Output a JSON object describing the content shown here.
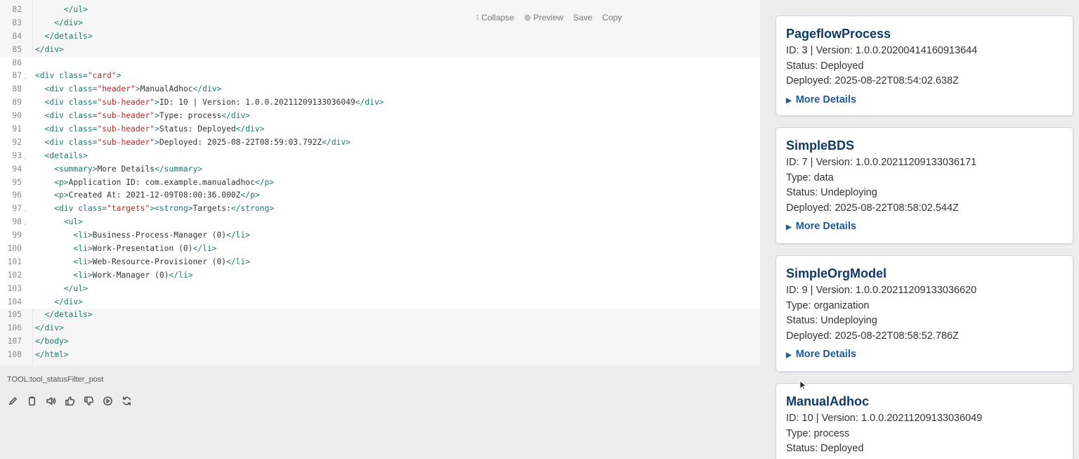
{
  "editor": {
    "toolbar": {
      "collapse": "⁝ Collapse",
      "preview": "⊚ Preview",
      "save": "Save",
      "copy": "Copy"
    },
    "lines": [
      {
        "n": "82",
        "fold": false,
        "hl": false,
        "indent": "      ",
        "parts": [
          [
            "tag",
            "</ul>"
          ]
        ]
      },
      {
        "n": "83",
        "fold": false,
        "hl": false,
        "indent": "    ",
        "parts": [
          [
            "tag",
            "</div>"
          ]
        ]
      },
      {
        "n": "84",
        "fold": false,
        "hl": false,
        "indent": "  ",
        "parts": [
          [
            "tag",
            "</details>"
          ]
        ]
      },
      {
        "n": "85",
        "fold": false,
        "hl": false,
        "indent": "",
        "parts": [
          [
            "tag",
            "</div>"
          ]
        ]
      },
      {
        "n": "86",
        "fold": false,
        "hl": true,
        "indent": "",
        "parts": []
      },
      {
        "n": "87",
        "fold": true,
        "hl": true,
        "indent": "",
        "parts": [
          [
            "tag",
            "<div "
          ],
          [
            "attr",
            "class="
          ],
          [
            "str",
            "\"card\""
          ],
          [
            "tag",
            ">"
          ]
        ]
      },
      {
        "n": "88",
        "fold": false,
        "hl": true,
        "indent": "  ",
        "parts": [
          [
            "tag",
            "<div "
          ],
          [
            "attr",
            "class="
          ],
          [
            "str",
            "\"header\""
          ],
          [
            "tag",
            ">"
          ],
          [
            "txt",
            "ManualAdhoc"
          ],
          [
            "tag",
            "</div>"
          ]
        ]
      },
      {
        "n": "89",
        "fold": false,
        "hl": true,
        "indent": "  ",
        "parts": [
          [
            "tag",
            "<div "
          ],
          [
            "attr",
            "class="
          ],
          [
            "str",
            "\"sub-header\""
          ],
          [
            "tag",
            ">"
          ],
          [
            "txt",
            "ID: 10 | Version: 1.0.0.20211209133036049"
          ],
          [
            "tag",
            "</div>"
          ]
        ]
      },
      {
        "n": "90",
        "fold": false,
        "hl": true,
        "indent": "  ",
        "parts": [
          [
            "tag",
            "<div "
          ],
          [
            "attr",
            "class="
          ],
          [
            "str",
            "\"sub-header\""
          ],
          [
            "tag",
            ">"
          ],
          [
            "txt",
            "Type: process"
          ],
          [
            "tag",
            "</div>"
          ]
        ]
      },
      {
        "n": "91",
        "fold": false,
        "hl": true,
        "indent": "  ",
        "parts": [
          [
            "tag",
            "<div "
          ],
          [
            "attr",
            "class="
          ],
          [
            "str",
            "\"sub-header\""
          ],
          [
            "tag",
            ">"
          ],
          [
            "txt",
            "Status: Deployed"
          ],
          [
            "tag",
            "</div>"
          ]
        ]
      },
      {
        "n": "92",
        "fold": false,
        "hl": true,
        "indent": "  ",
        "parts": [
          [
            "tag",
            "<div "
          ],
          [
            "attr",
            "class="
          ],
          [
            "str",
            "\"sub-header\""
          ],
          [
            "tag",
            ">"
          ],
          [
            "txt",
            "Deployed: 2025-08-22T08:59:03.792Z"
          ],
          [
            "tag",
            "</div>"
          ]
        ]
      },
      {
        "n": "93",
        "fold": true,
        "hl": true,
        "indent": "  ",
        "parts": [
          [
            "tag",
            "<details>"
          ]
        ]
      },
      {
        "n": "94",
        "fold": false,
        "hl": true,
        "indent": "    ",
        "parts": [
          [
            "tag",
            "<summary>"
          ],
          [
            "txt",
            "More Details"
          ],
          [
            "tag",
            "</summary>"
          ]
        ]
      },
      {
        "n": "95",
        "fold": false,
        "hl": true,
        "indent": "    ",
        "parts": [
          [
            "tag",
            "<p>"
          ],
          [
            "txt",
            "Application ID: com.example.manualadhoc"
          ],
          [
            "tag",
            "</p>"
          ]
        ]
      },
      {
        "n": "96",
        "fold": false,
        "hl": true,
        "indent": "    ",
        "parts": [
          [
            "tag",
            "<p>"
          ],
          [
            "txt",
            "Created At: 2021-12-09T08:00:36.000Z"
          ],
          [
            "tag",
            "</p>"
          ]
        ]
      },
      {
        "n": "97",
        "fold": true,
        "hl": true,
        "indent": "    ",
        "parts": [
          [
            "tag",
            "<div "
          ],
          [
            "attr",
            "class="
          ],
          [
            "str",
            "\"targets\""
          ],
          [
            "tag",
            "><strong>"
          ],
          [
            "txt",
            "Targets:"
          ],
          [
            "tag",
            "</strong>"
          ]
        ]
      },
      {
        "n": "98",
        "fold": true,
        "hl": true,
        "indent": "      ",
        "parts": [
          [
            "tag",
            "<ul>"
          ]
        ]
      },
      {
        "n": "99",
        "fold": false,
        "hl": true,
        "indent": "        ",
        "parts": [
          [
            "tag",
            "<li>"
          ],
          [
            "txt",
            "Business-Process-Manager (0)"
          ],
          [
            "tag",
            "</li>"
          ]
        ]
      },
      {
        "n": "100",
        "fold": false,
        "hl": true,
        "indent": "        ",
        "parts": [
          [
            "tag",
            "<li>"
          ],
          [
            "txt",
            "Work-Presentation (0)"
          ],
          [
            "tag",
            "</li>"
          ]
        ]
      },
      {
        "n": "101",
        "fold": false,
        "hl": true,
        "indent": "        ",
        "parts": [
          [
            "tag",
            "<li>"
          ],
          [
            "txt",
            "Web-Resource-Provisioner (0)"
          ],
          [
            "tag",
            "</li>"
          ]
        ]
      },
      {
        "n": "102",
        "fold": false,
        "hl": true,
        "indent": "        ",
        "parts": [
          [
            "tag",
            "<li>"
          ],
          [
            "txt",
            "Work-Manager (0)"
          ],
          [
            "tag",
            "</li>"
          ]
        ]
      },
      {
        "n": "103",
        "fold": false,
        "hl": true,
        "indent": "      ",
        "parts": [
          [
            "tag",
            "</ul>"
          ]
        ]
      },
      {
        "n": "104",
        "fold": false,
        "hl": true,
        "indent": "    ",
        "parts": [
          [
            "tag",
            "</div>"
          ]
        ]
      },
      {
        "n": "105",
        "fold": false,
        "hl": false,
        "indent": "  ",
        "parts": [
          [
            "tag",
            "</details>"
          ]
        ]
      },
      {
        "n": "106",
        "fold": false,
        "hl": false,
        "indent": "",
        "parts": [
          [
            "tag",
            "</div>"
          ]
        ]
      },
      {
        "n": "107",
        "fold": false,
        "hl": false,
        "indent": "",
        "parts": [
          [
            "tag",
            "</body>"
          ]
        ]
      },
      {
        "n": "108",
        "fold": false,
        "hl": false,
        "indent": "",
        "parts": [
          [
            "tag",
            "</html>"
          ]
        ]
      }
    ]
  },
  "tool_label": "TOOL:tool_statusFilter_post",
  "actions": [
    "edit-icon",
    "copy-icon",
    "speaker-icon",
    "thumbs-up-icon",
    "thumbs-down-icon",
    "play-icon",
    "refresh-icon"
  ],
  "cards": [
    {
      "header": "PageflowProcess",
      "lines": [
        "ID: 3 | Version: 1.0.0.20200414160913644",
        "Status: Deployed",
        "Deployed: 2025-08-22T08:54:02.638Z"
      ],
      "more": "More Details"
    },
    {
      "header": "SimpleBDS",
      "lines": [
        "ID: 7 | Version: 1.0.0.20211209133036171",
        "Type: data",
        "Status: Undeploying",
        "Deployed: 2025-08-22T08:58:02.544Z"
      ],
      "more": "More Details"
    },
    {
      "header": "SimpleOrgModel",
      "lines": [
        "ID: 9 | Version: 1.0.0.20211209133036620",
        "Type: organization",
        "Status: Undeploying",
        "Deployed: 2025-08-22T08:58:52.786Z"
      ],
      "more": "More Details"
    },
    {
      "header": "ManualAdhoc",
      "lines": [
        "ID: 10 | Version: 1.0.0.20211209133036049",
        "Type: process",
        "Status: Deployed"
      ],
      "more": ""
    }
  ],
  "colors": {
    "card_header": "#0f3a68",
    "link": "#1e5a96",
    "tag": "#1a7a6a",
    "string": "#b22a2a"
  }
}
